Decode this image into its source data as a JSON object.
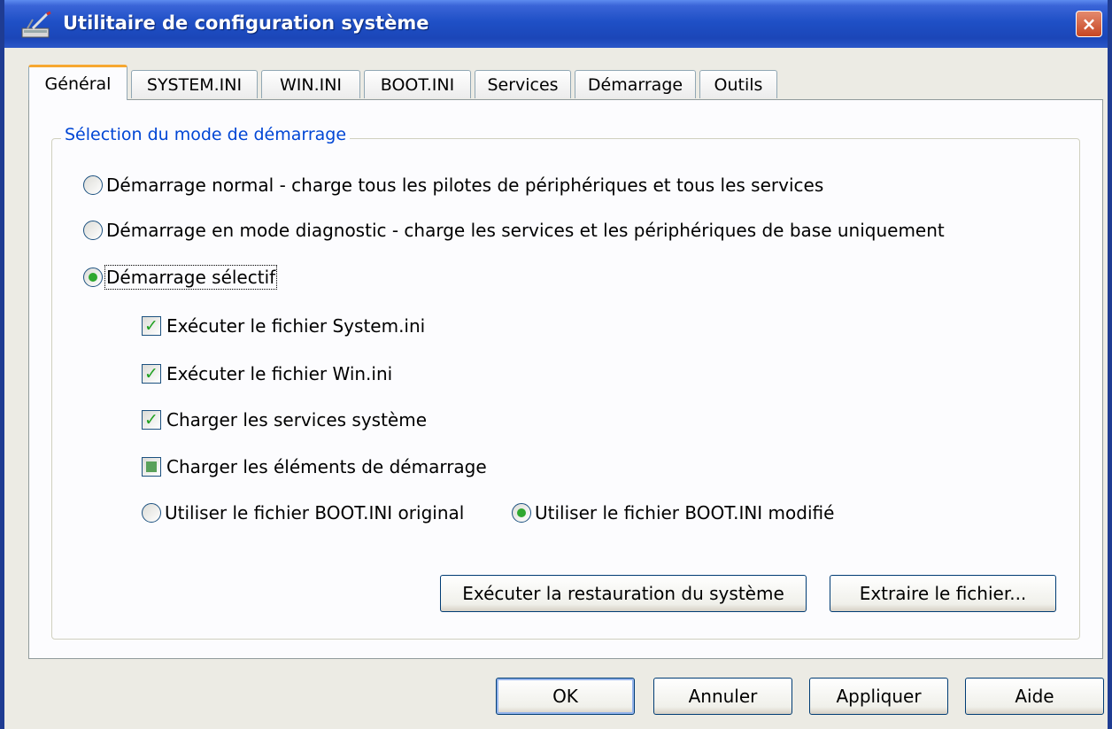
{
  "window": {
    "title": "Utilitaire de configuration système",
    "close_glyph": "×"
  },
  "tabs": [
    {
      "label": "Général",
      "active": true
    },
    {
      "label": "SYSTEM.INI",
      "active": false
    },
    {
      "label": "WIN.INI",
      "active": false
    },
    {
      "label": "BOOT.INI",
      "active": false
    },
    {
      "label": "Services",
      "active": false
    },
    {
      "label": "Démarrage",
      "active": false
    },
    {
      "label": "Outils",
      "active": false
    }
  ],
  "startup_mode": {
    "group_label": "Sélection du mode de démarrage",
    "options": [
      {
        "label": "Démarrage normal - charge tous les pilotes de périphériques et tous les services",
        "selected": false
      },
      {
        "label": "Démarrage en mode diagnostic - charge les services et les périphériques de base uniquement",
        "selected": false
      },
      {
        "label": "Démarrage sélectif",
        "selected": true
      }
    ],
    "selective": {
      "checkboxes": [
        {
          "label": "Exécuter le fichier System.ini",
          "state": "checked"
        },
        {
          "label": "Exécuter le fichier Win.ini",
          "state": "checked"
        },
        {
          "label": "Charger les services système",
          "state": "checked"
        },
        {
          "label": "Charger les éléments de démarrage",
          "state": "indeterminate"
        }
      ],
      "boot_ini": [
        {
          "label": "Utiliser le fichier BOOT.INI original",
          "selected": false
        },
        {
          "label": "Utiliser le fichier BOOT.INI modifié",
          "selected": true
        }
      ]
    },
    "buttons": {
      "restore": "Exécuter la restauration du système",
      "extract": "Extraire le fichier..."
    }
  },
  "dialog_buttons": {
    "ok": "OK",
    "cancel": "Annuler",
    "apply": "Appliquer",
    "help": "Aide"
  },
  "icons": {
    "app": "msconfig-icon",
    "close": "close-icon",
    "check": "checkmark-icon",
    "check_glyph": "✓"
  }
}
